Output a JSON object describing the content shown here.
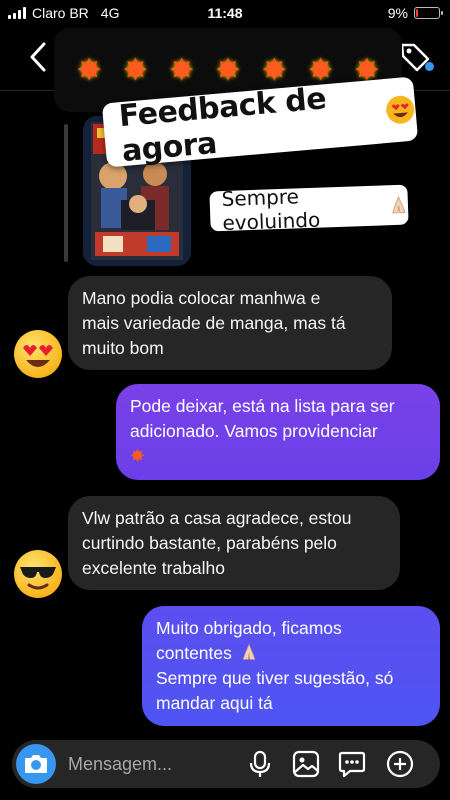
{
  "status_bar": {
    "carrier": "Claro BR",
    "network": "4G",
    "time": "11:48",
    "battery": "9%",
    "battery_level": 0.09,
    "battery_color": "#ff3b30"
  },
  "header": {
    "back_icon": "chevron-left-icon",
    "tag_icon": "tag-icon",
    "dot_color": "#3797f0"
  },
  "story_reply": {
    "stars_icon": "starburst-icon",
    "feedback_sticker": "Feedback de agora",
    "feedback_emoji": "heart-eyes-emoji",
    "evolving_sticker": "Sempre evoluindo",
    "evolving_emoji": "folded-hands-emoji"
  },
  "messages": [
    {
      "direction": "incoming",
      "avatar": "heart-eyes-emoji",
      "lines": [
        "Mano podia colocar manhwa e",
        "mais variedade de manga, mas tá",
        "muito bom"
      ]
    },
    {
      "direction": "outgoing",
      "lines": [
        "Pode deixar, está na lista para ser",
        "adicionado. Vamos providenciar"
      ],
      "emoji": "collision-emoji",
      "color": "#7a41e8"
    },
    {
      "direction": "incoming",
      "avatar": "sunglasses-emoji",
      "lines": [
        "Vlw patrão a casa agradece, estou",
        "curtindo bastante, parabéns pelo",
        "excelente trabalho"
      ]
    },
    {
      "direction": "outgoing",
      "lines": [
        "Muito obrigado, ficamos",
        "contentes",
        "Sempre que tiver sugestão, só",
        "mandar aqui tá"
      ],
      "emoji": "folded-hands-emoji",
      "color": "#5c4ef0"
    }
  ],
  "composer": {
    "placeholder": "Mensagem...",
    "camera_icon": "camera-icon",
    "mic_icon": "microphone-icon",
    "gallery_icon": "gallery-icon",
    "sticker_icon": "sticker-icon",
    "add_icon": "plus-circle-icon",
    "camera_color": "#3797f0"
  }
}
